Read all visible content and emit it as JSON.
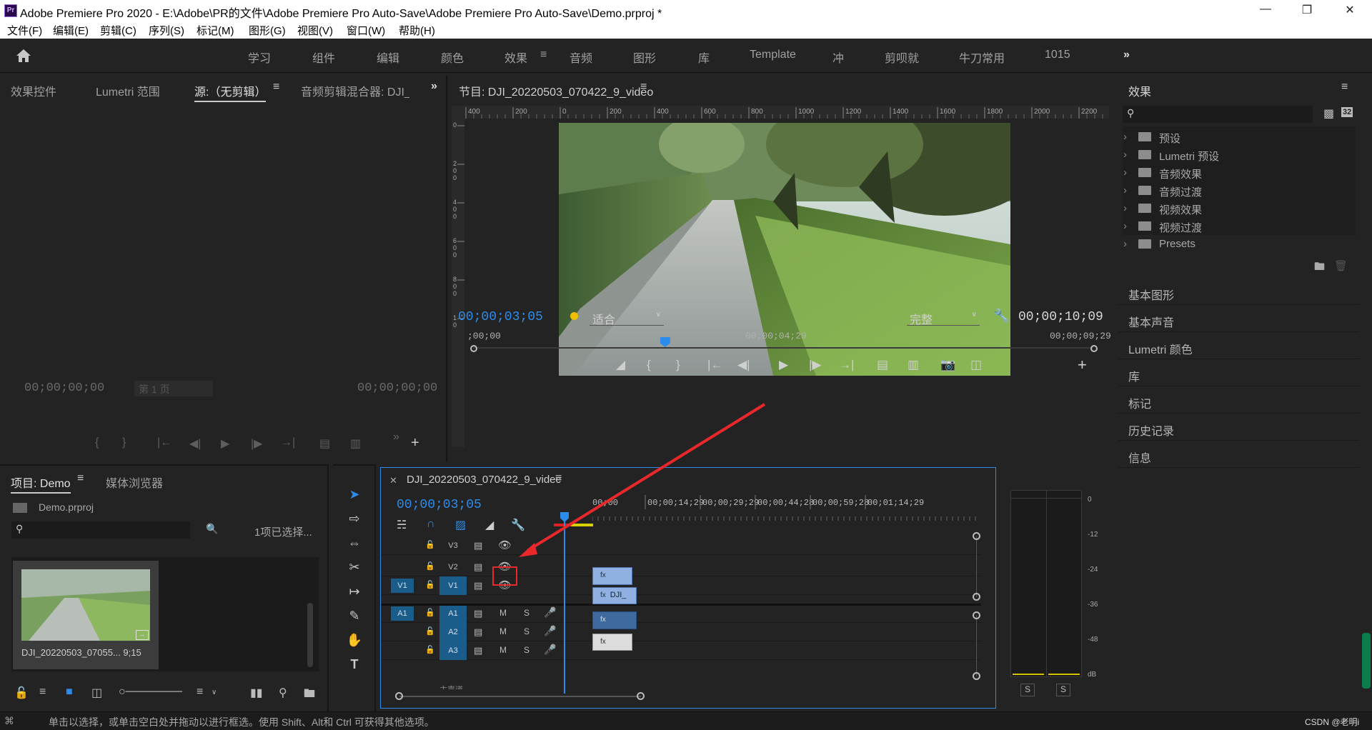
{
  "app": {
    "title": "Adobe Premiere Pro 2020 - E:\\Adobe\\PR的文件\\Adobe Premiere Pro Auto-Save\\Adobe Premiere Pro Auto-Save\\Demo.prproj *",
    "logo": "Pr"
  },
  "menu": [
    "文件(F)",
    "编辑(E)",
    "剪辑(C)",
    "序列(S)",
    "标记(M)",
    "图形(G)",
    "视图(V)",
    "窗口(W)",
    "帮助(H)"
  ],
  "workspaces": [
    "学习",
    "组件",
    "编辑",
    "颜色",
    "效果",
    "音频",
    "图形",
    "库",
    "Template",
    "冲",
    "剪呗就",
    "牛刀常用",
    "1015"
  ],
  "source": {
    "tabs": [
      "效果控件",
      "Lumetri 范围",
      "源:（无剪辑）",
      "音频剪辑混合器: DJI_"
    ],
    "tc_left": "00;00;00;00",
    "tc_right": "00;00;00;00",
    "page": "第 1 页"
  },
  "program": {
    "tab": "节目: DJI_20220503_070422_9_video",
    "ruler_top": [
      "400",
      "200",
      "0",
      "200",
      "400",
      "600",
      "800",
      "1000",
      "1200",
      "1400",
      "1600",
      "1800",
      "2000",
      "2200"
    ],
    "ruler_left": [
      "0",
      "2 0 0",
      "4 0 0",
      "6 0 0",
      "8 0 0",
      "1 0"
    ],
    "tc_current": "00;00;03;05",
    "fit": "适合",
    "quality": "完整",
    "tc_duration": "00;00;10;09",
    "time_start": ";00;00",
    "time_mid": "00;00;04;29",
    "time_end": "00;00;09;29",
    "playhead": 0.31
  },
  "effects": {
    "title": "效果",
    "badge": "32",
    "items": [
      "预设",
      "Lumetri 预设",
      "音频效果",
      "音频过渡",
      "视频效果",
      "视频过渡",
      "Presets"
    ],
    "panels": [
      "基本图形",
      "基本声音",
      "Lumetri 颜色",
      "库",
      "标记",
      "历史记录",
      "信息"
    ]
  },
  "project": {
    "tabs": [
      "项目: Demo",
      "媒体浏览器"
    ],
    "file": "Demo.prproj",
    "selected": "1项已选择...",
    "clip_name": "DJI_20220503_07055... 9;15"
  },
  "timeline": {
    "tab": "DJI_20220503_070422_9_videc",
    "tc": "00;00;03;05",
    "ruler": [
      "00;00",
      "00;00;14;29",
      "00;00;29;29",
      "00;00;44;28",
      "00;00;59;28",
      "00;01;14;29"
    ],
    "video_tracks": [
      "V3",
      "V2",
      "V1"
    ],
    "audio_tracks": [
      "A1",
      "A2",
      "A3"
    ],
    "src_v": "V1",
    "src_a": "A1",
    "clip_label": "DJI_",
    "mix_label": "主声道"
  },
  "meter": {
    "scale": [
      "0",
      "-12",
      "-24",
      "-36",
      "-48",
      "dB"
    ],
    "solo": [
      "S",
      "S"
    ]
  },
  "status": {
    "text": "单击以选择，或单击空白处并拖动以进行框选。使用 Shift、Alt和 Ctrl 可获得其他选项。",
    "watermark": "CSDN @老明i"
  },
  "colors": {
    "accent": "#2d8ceb",
    "annotation": "#e8282b",
    "track_blue": "#1a5d8a",
    "clip_video": "#8fb0e0",
    "clip_audio": "#3f6aa0"
  }
}
